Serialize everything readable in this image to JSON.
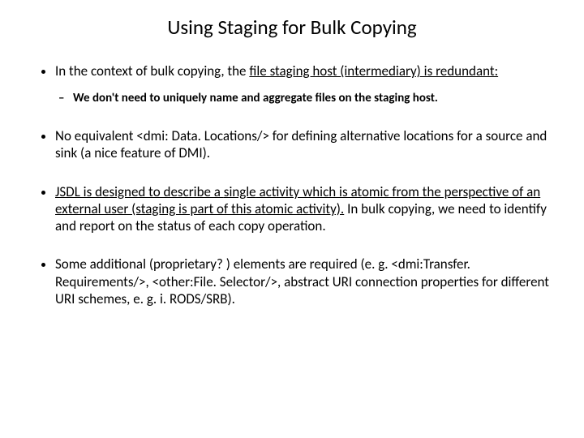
{
  "title": "Using Staging for Bulk Copying",
  "bullets": {
    "b1_pre": "In the context of bulk copying, the ",
    "b1_u": "file staging host (intermediary) is redundant:",
    "b1_sub": "We don't need to uniquely name and aggregate files on the staging host.",
    "b2": "No equivalent <dmi: Data. Locations/> for defining alternative locations for a source and sink (a nice feature of DMI).",
    "b3_u": "JSDL is designed to describe a ",
    "b3_u2": "single",
    "b3_u3": " activity which is atomic from the perspective of an external user (staging is part of this atomic activity).",
    "b3_post": " In bulk copying, we need to identify and report on the status of each copy operation.",
    "b4": "Some additional (proprietary? ) elements are required (e. g. <dmi:Transfer. Requirements/>, <other:File. Selector/>, abstract URI connection properties for different URI schemes, e. g. i. RODS/SRB)."
  }
}
